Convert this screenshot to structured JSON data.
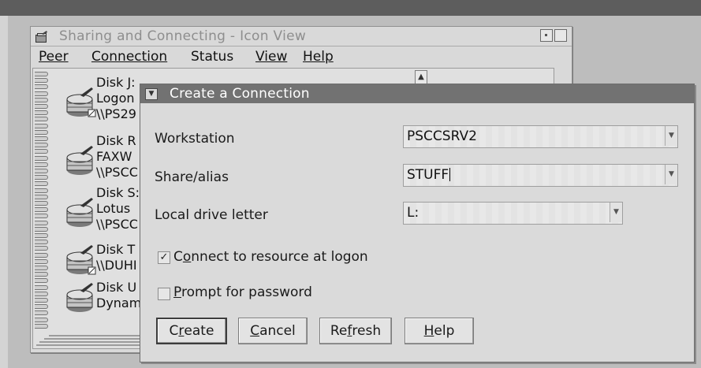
{
  "main_window": {
    "title": "Sharing and Connecting - Icon View",
    "menu": [
      "Peer",
      "Connection",
      "Status",
      "View",
      "Help"
    ],
    "items": [
      {
        "lines": [
          "Disk J:",
          "Logon",
          "\\\\PS29"
        ]
      },
      {
        "lines": [
          "Disk R",
          "FAXW",
          "\\\\PSCC"
        ]
      },
      {
        "lines": [
          "Disk S:",
          "Lotus",
          "\\\\PSCC"
        ]
      },
      {
        "lines": [
          "Disk T",
          "\\\\DUHI"
        ]
      },
      {
        "lines": [
          "Disk U",
          "Dynam"
        ]
      }
    ]
  },
  "dialog": {
    "title": "Create a Connection",
    "workstation": {
      "label": "Workstation",
      "value": "PSCCSRV2"
    },
    "share": {
      "label": "Share/alias",
      "value": "STUFF"
    },
    "drive": {
      "label": "Local drive letter",
      "value": "L:"
    },
    "connect_logon": {
      "label_pre": "C",
      "label_ul": "o",
      "label_post": "nnect to resource at logon",
      "checked": true,
      "mark": "✓"
    },
    "prompt_password": {
      "label_ul": "P",
      "label_post": "rompt for password",
      "checked": false
    },
    "buttons": {
      "create": {
        "pre": "C",
        "ul": "r",
        "post": "eate"
      },
      "cancel": {
        "pre": "",
        "ul": "C",
        "post": "ancel"
      },
      "refresh": {
        "pre": "Re",
        "ul": "f",
        "post": "resh"
      },
      "help": {
        "pre": "",
        "ul": "H",
        "post": "elp"
      }
    }
  },
  "icons": {
    "system": "folder-icon",
    "disk": "disk-icon",
    "dropdown": "chevron-down-icon"
  }
}
